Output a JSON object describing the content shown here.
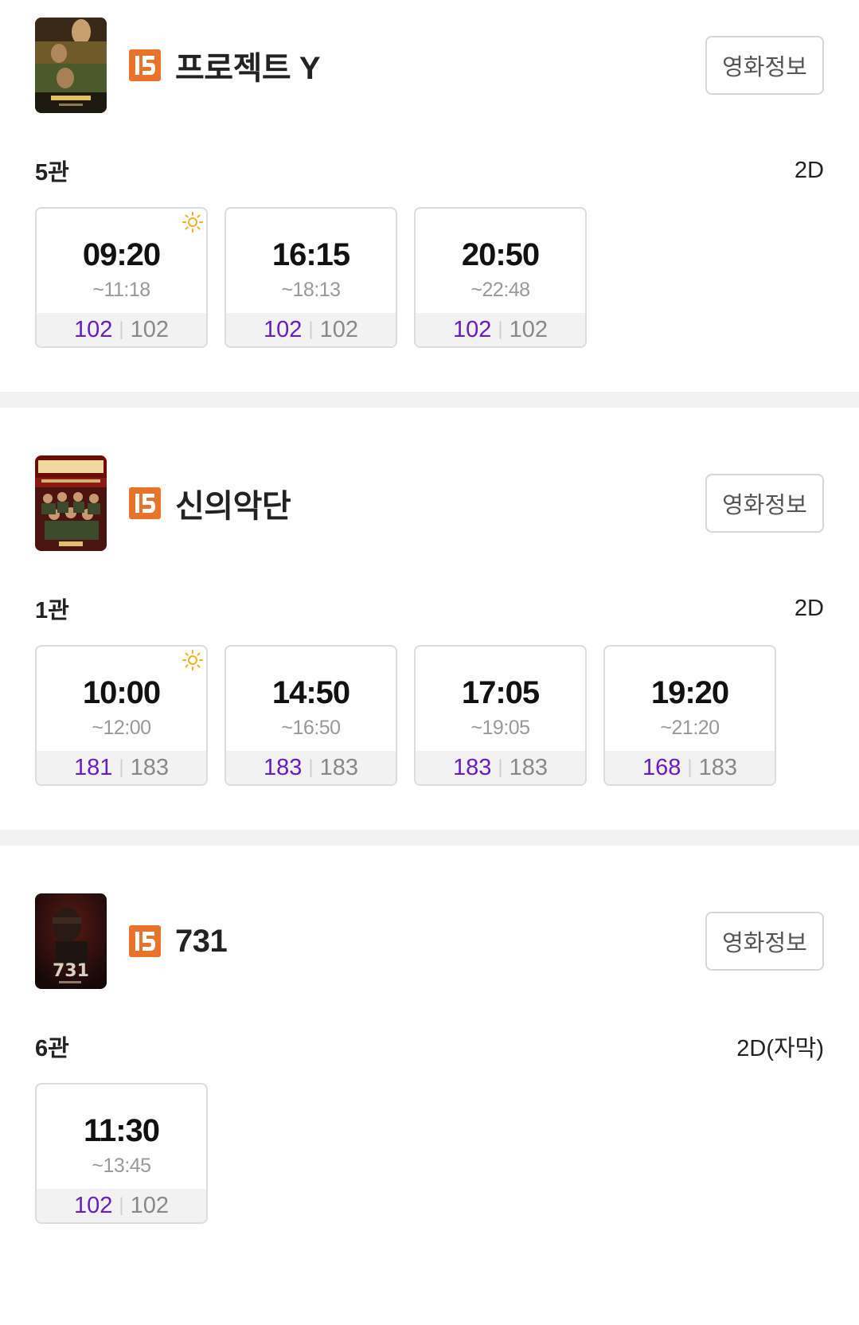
{
  "movies": [
    {
      "title": "프로젝트 Y",
      "rating": "15",
      "info_button": "영화정보",
      "poster_icon": "movie-poster",
      "halls": [
        {
          "name": "5관",
          "format": "2D",
          "showtimes": [
            {
              "start": "09:20",
              "end": "~11:18",
              "available": "102",
              "total": "102",
              "morning": true
            },
            {
              "start": "16:15",
              "end": "~18:13",
              "available": "102",
              "total": "102",
              "morning": false
            },
            {
              "start": "20:50",
              "end": "~22:48",
              "available": "102",
              "total": "102",
              "morning": false
            }
          ]
        }
      ]
    },
    {
      "title": "신의악단",
      "rating": "15",
      "info_button": "영화정보",
      "poster_icon": "movie-poster",
      "halls": [
        {
          "name": "1관",
          "format": "2D",
          "showtimes": [
            {
              "start": "10:00",
              "end": "~12:00",
              "available": "181",
              "total": "183",
              "morning": true
            },
            {
              "start": "14:50",
              "end": "~16:50",
              "available": "183",
              "total": "183",
              "morning": false
            },
            {
              "start": "17:05",
              "end": "~19:05",
              "available": "183",
              "total": "183",
              "morning": false
            },
            {
              "start": "19:20",
              "end": "~21:20",
              "available": "168",
              "total": "183",
              "morning": false
            }
          ]
        }
      ]
    },
    {
      "title": "731",
      "rating": "15",
      "info_button": "영화정보",
      "poster_icon": "movie-poster",
      "halls": [
        {
          "name": "6관",
          "format": "2D(자막)",
          "showtimes": [
            {
              "start": "11:30",
              "end": "~13:45",
              "available": "102",
              "total": "102",
              "morning": false
            }
          ]
        }
      ]
    }
  ],
  "colors": {
    "rating_badge": "#e8742c",
    "seats_available": "#6a1bc4",
    "seats_total": "#888888",
    "morning_icon": "#f0b020",
    "divider": "#f2f2f2"
  },
  "icons": {
    "rating": "rating-15-icon",
    "morning": "sun-icon"
  }
}
